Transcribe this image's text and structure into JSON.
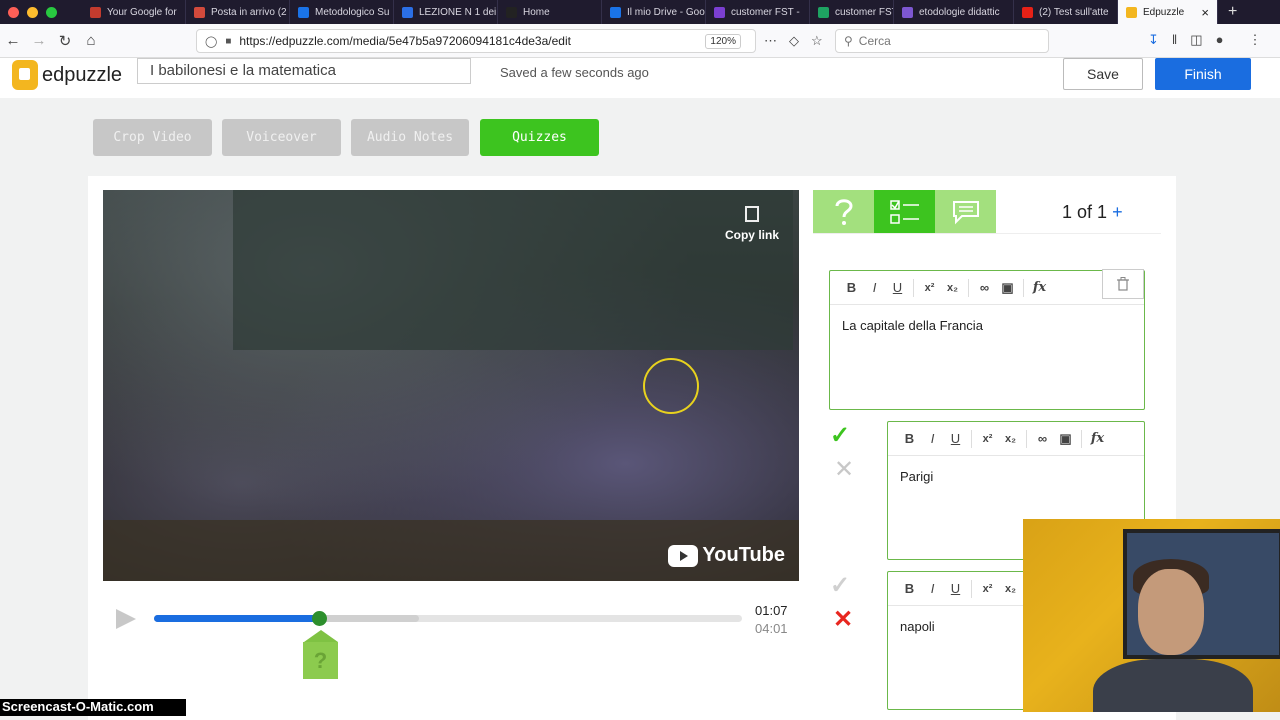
{
  "browser": {
    "tabs": [
      {
        "label": "Your Google for",
        "color": "#c23b2e"
      },
      {
        "label": "Posta in arrivo (2",
        "color": "#d24a3c"
      },
      {
        "label": "Metodologico Su",
        "color": "#1a73e8"
      },
      {
        "label": "LEZIONE N 1 dei",
        "color": "#2b6fe6"
      },
      {
        "label": "Home",
        "color": "#222222"
      },
      {
        "label": "Il mio Drive - Goo",
        "color": "#1a73e8"
      },
      {
        "label": "customer FST -",
        "color": "#7b3fd1"
      },
      {
        "label": "customer FST",
        "color": "#1ea362"
      },
      {
        "label": "etodologie didattic",
        "color": "#7d57d1"
      },
      {
        "label": "(2) Test sull'atte",
        "color": "#e62117"
      },
      {
        "label": "Edpuzzle",
        "color": "#f3b61f"
      }
    ],
    "url": "https://edpuzzle.com/media/5e47b5a97206094181c4de3a/edit",
    "zoom": "120%",
    "search_placeholder": "Cerca"
  },
  "header": {
    "brand": "edpuzzle",
    "video_title": "I babilonesi e la matematica",
    "status": "Saved a few seconds ago",
    "save_label": "Save",
    "finish_label": "Finish"
  },
  "tools": [
    {
      "label": "Crop Video",
      "active": false
    },
    {
      "label": "Voiceover",
      "active": false
    },
    {
      "label": "Audio Notes",
      "active": false
    },
    {
      "label": "Quizzes",
      "active": true
    }
  ],
  "video": {
    "copy_link_label": "Copy link",
    "provider": "YouTube",
    "current_time": "01:07",
    "total_time": "04:01",
    "progress_fraction": 0.28,
    "buffer_fraction": 0.45,
    "marker_label": "?"
  },
  "quiz": {
    "counter": "1 of 1",
    "add_label": "+",
    "question": "La capitale della Francia",
    "answers": [
      {
        "text": "Parigi",
        "correct": true
      },
      {
        "text": "napoli",
        "correct": false
      }
    ]
  },
  "overlay": {
    "watermark": "Screencast-O-Matic.com"
  },
  "colors": {
    "accent_green": "#3dc41f",
    "accent_blue": "#1a6de0",
    "correct": "#3dc41f",
    "wrong": "#e8261f"
  }
}
